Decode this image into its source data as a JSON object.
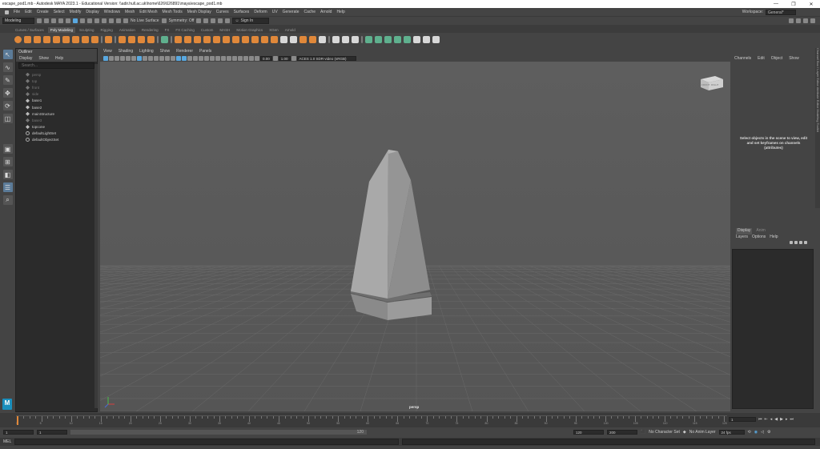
{
  "titlebar": {
    "title": "escape_pod1.mb - Autodesk MAYA 2023.1 - Educational Version: \\\\adir.hull.ac.uk\\home\\626\\626891\\maya\\escape_pod1.mb",
    "minimize": "—",
    "maximize": "❐",
    "close": "✕"
  },
  "menubar": {
    "items": [
      "File",
      "Edit",
      "Create",
      "Select",
      "Modify",
      "Display",
      "Windows",
      "Mesh",
      "Edit Mesh",
      "Mesh Tools",
      "Mesh Display",
      "Curves",
      "Surfaces",
      "Deform",
      "UV",
      "Generate",
      "Cache",
      "Arnold",
      "Help"
    ],
    "workspace_label": "Workspace:",
    "workspace_value": "General*"
  },
  "statusline": {
    "mode": "Modeling",
    "live_surface": "No Live Surface",
    "symmetry": "Symmetry: Off",
    "sign_in": "Sign In"
  },
  "shelf": {
    "tabs": [
      "Curves / Surfaces",
      "Poly Modeling",
      "Sculpting",
      "Rigging",
      "Animation",
      "Rendering",
      "FX",
      "FX Caching",
      "Custom",
      "MASH",
      "Motion Graphics",
      "XGen",
      "Arnold"
    ],
    "active_tab": "Poly Modeling"
  },
  "outliner": {
    "title": "Outliner",
    "menu": [
      "Display",
      "Show",
      "Help"
    ],
    "search_placeholder": "Search...",
    "items": [
      {
        "label": "persp",
        "dim": true
      },
      {
        "label": "top",
        "dim": true
      },
      {
        "label": "front",
        "dim": true
      },
      {
        "label": "side",
        "dim": true
      },
      {
        "label": "base1",
        "dim": false
      },
      {
        "label": "base2",
        "dim": false
      },
      {
        "label": "mainStructure",
        "dim": false
      },
      {
        "label": "base3",
        "dim": true
      },
      {
        "label": "topcone",
        "dim": false
      },
      {
        "label": "defaultLightSet",
        "dim": false,
        "light": true
      },
      {
        "label": "defaultObjectSet",
        "dim": false,
        "light": true
      }
    ]
  },
  "viewport": {
    "menu": [
      "View",
      "Shading",
      "Lighting",
      "Show",
      "Renderer",
      "Panels"
    ],
    "exposure": "0.00",
    "gamma": "1.00",
    "color_space": "ACES 1.0 SDR-video (sRGB)",
    "camera_label": "persp",
    "viewcube_left": "FRONT",
    "viewcube_right": "RIGHT"
  },
  "channelbox": {
    "tabs": [
      "Channels",
      "Edit",
      "Object",
      "Show"
    ],
    "message": "Select objects in the scene to view, edit and set keyframes on channels (attributes)"
  },
  "layers": {
    "tabs": [
      "Display",
      "Anim"
    ],
    "menu": [
      "Layers",
      "Options",
      "Help"
    ]
  },
  "sidetabs": {
    "label": "Channel Box / Layer Editor   Attribute Editor   Modeling Toolkit"
  },
  "timeslider": {
    "labels": [
      "1",
      "5",
      "10",
      "15",
      "20",
      "25",
      "30",
      "35",
      "40",
      "45",
      "50",
      "55",
      "60",
      "65",
      "70",
      "75",
      "80",
      "85",
      "90",
      "95",
      "100",
      "105",
      "110",
      "115",
      "120"
    ],
    "current_frame": "1"
  },
  "range": {
    "start": "1",
    "inner_start": "1",
    "range_label": "120",
    "inner_end": "120",
    "end": "200",
    "character_set": "No Character Set",
    "anim_layer": "No Anim Layer",
    "fps": "24 fps"
  },
  "cmdline": {
    "language": "MEL"
  }
}
